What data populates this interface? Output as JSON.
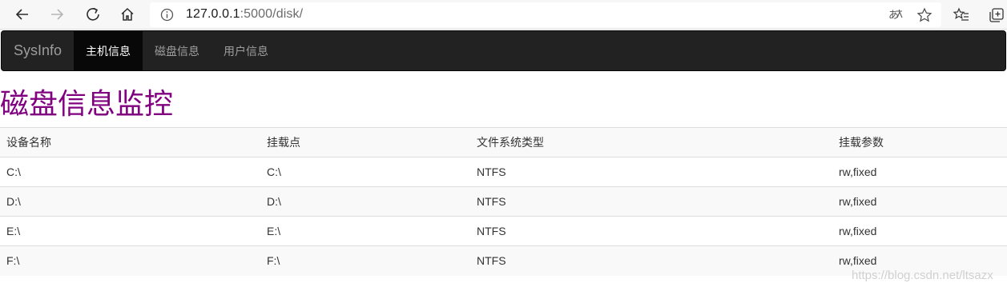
{
  "browser": {
    "url_host": "127.0.0.1",
    "url_rest": ":5000/disk/"
  },
  "navbar": {
    "brand": "SysInfo",
    "items": [
      {
        "label": "主机信息",
        "active": true
      },
      {
        "label": "磁盘信息",
        "active": false
      },
      {
        "label": "用户信息",
        "active": false
      }
    ]
  },
  "page": {
    "title": "磁盘信息监控",
    "title_color": "#800080"
  },
  "table": {
    "headers": [
      "设备名称",
      "挂载点",
      "文件系统类型",
      "挂载参数"
    ],
    "rows": [
      [
        "C:\\",
        "C:\\",
        "NTFS",
        "rw,fixed"
      ],
      [
        "D:\\",
        "D:\\",
        "NTFS",
        "rw,fixed"
      ],
      [
        "E:\\",
        "E:\\",
        "NTFS",
        "rw,fixed"
      ],
      [
        "F:\\",
        "F:\\",
        "NTFS",
        "rw,fixed"
      ]
    ]
  },
  "watermark": "https://blog.csdn.net/ltsazx"
}
